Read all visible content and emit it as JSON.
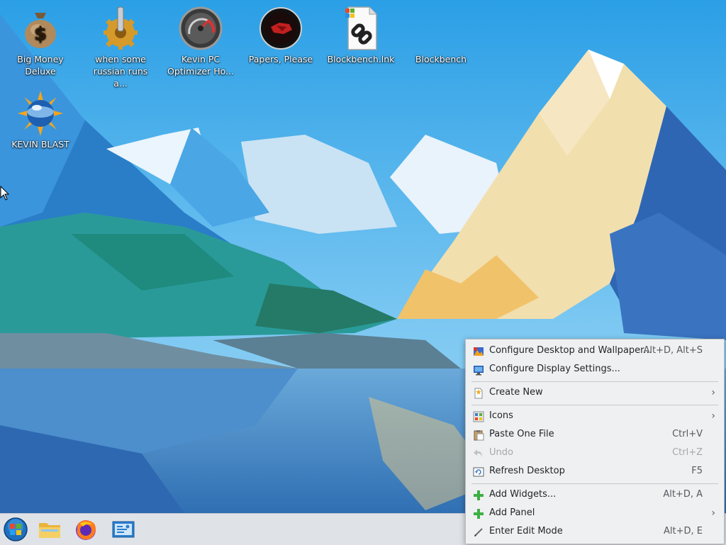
{
  "desktop": {
    "icons": [
      {
        "label": "Big Money Deluxe",
        "icon": "money-bag-icon"
      },
      {
        "label": "when some russian runs a...",
        "icon": "gear-icon"
      },
      {
        "label": "Kevin PC Optimizer Ho...",
        "icon": "gauge-icon"
      },
      {
        "label": "Papers, Please",
        "icon": "papers-please-icon"
      },
      {
        "label": "Blockbench.lnk",
        "icon": "shortcut-link-icon"
      },
      {
        "label": "Blockbench",
        "icon": "blank-icon"
      },
      {
        "label": "KEVIN BLAST",
        "icon": "sun-globe-icon"
      }
    ]
  },
  "context_menu": {
    "items": [
      {
        "label": "Configure Desktop and Wallpaper...",
        "shortcut": "Alt+D, Alt+S",
        "icon": "wallpaper-icon"
      },
      {
        "label": "Configure Display Settings...",
        "shortcut": "",
        "icon": "display-icon"
      },
      {
        "label": "Create New",
        "shortcut": "",
        "icon": "new-file-icon",
        "submenu": "›"
      },
      {
        "label": "Icons",
        "shortcut": "",
        "icon": "icons-icon",
        "submenu": "›"
      },
      {
        "label": "Paste One File",
        "shortcut": "Ctrl+V",
        "icon": "paste-icon"
      },
      {
        "label": "Undo",
        "shortcut": "Ctrl+Z",
        "icon": "undo-icon",
        "disabled": true
      },
      {
        "label": "Refresh Desktop",
        "shortcut": "F5",
        "icon": "refresh-icon"
      },
      {
        "label": "Add Widgets...",
        "shortcut": "Alt+D, A",
        "icon": "add-icon"
      },
      {
        "label": "Add Panel",
        "shortcut": "",
        "icon": "add-icon",
        "submenu": "›"
      },
      {
        "label": "Enter Edit Mode",
        "shortcut": "Alt+D, E",
        "icon": "edit-icon"
      }
    ]
  },
  "taskbar": {
    "items": [
      {
        "icon": "start-menu-icon"
      },
      {
        "icon": "file-manager-icon"
      },
      {
        "icon": "firefox-icon"
      },
      {
        "icon": "system-settings-icon"
      }
    ]
  }
}
